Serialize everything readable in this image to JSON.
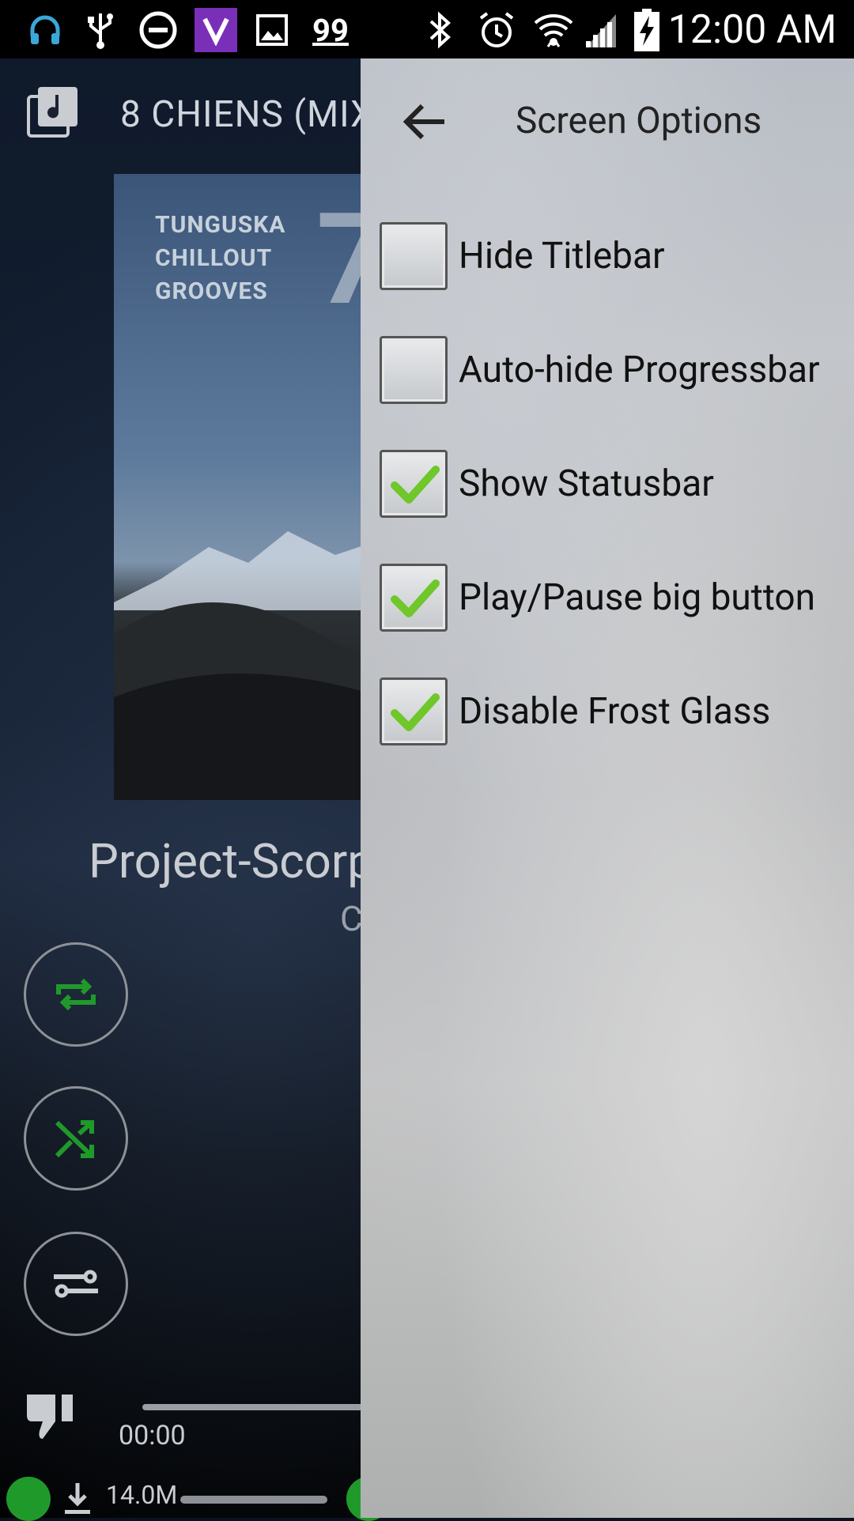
{
  "status_bar": {
    "time": "12:00 AM",
    "notification_count": "99",
    "icons": [
      "headphones-icon",
      "usb-icon",
      "do-not-disturb-icon",
      "app-v-icon",
      "image-icon",
      "notification-99-icon",
      "bluetooth-icon",
      "alarm-icon",
      "wifi-icon",
      "cell-signal-icon",
      "battery-charging-icon"
    ]
  },
  "player": {
    "header_title": "8 CHIENS (MIX",
    "album_text": "TUNGUSKA\nCHILLOUT\nGROOVES",
    "album_number": "7",
    "song_title": "Project-Scorp",
    "song_subtitle": "C",
    "elapsed": "00:00",
    "download_size": "14.0M",
    "accent_color": "#1f9a2a"
  },
  "panel": {
    "title": "Screen Options",
    "options": [
      {
        "label": "Hide Titlebar",
        "checked": false
      },
      {
        "label": "Auto-hide Progressbar",
        "checked": false
      },
      {
        "label": "Show Statusbar",
        "checked": true
      },
      {
        "label": "Play/Pause big button",
        "checked": true
      },
      {
        "label": "Disable Frost Glass",
        "checked": true
      }
    ]
  }
}
